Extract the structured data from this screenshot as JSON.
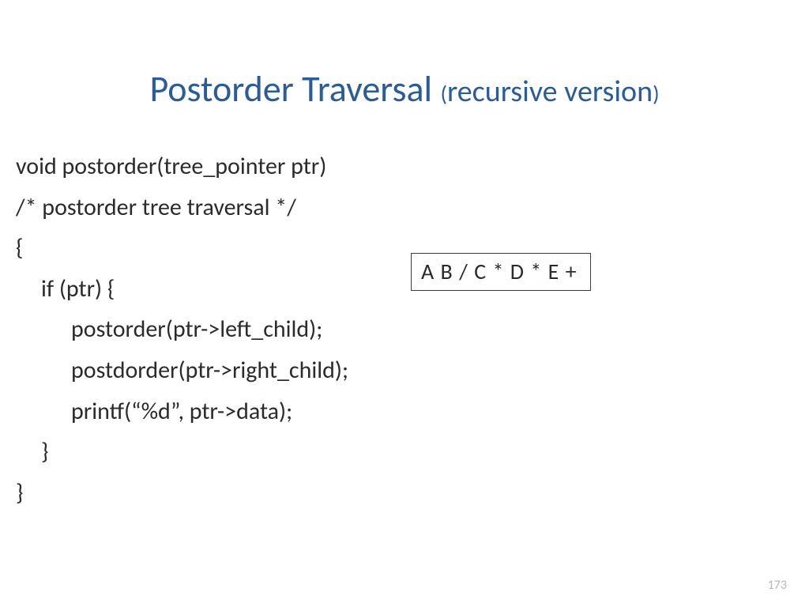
{
  "title": {
    "main": "Postorder Traversal",
    "open_paren": "(",
    "sub": "recursive  version",
    "close_paren": ")"
  },
  "code": {
    "l1": "void postorder(tree_pointer ptr)",
    "l2": "/* postorder tree traversal */",
    "l3": "{",
    "l4": "if (ptr) {",
    "l5": "postorder(ptr->left_child);",
    "l6": "postdorder(ptr->right_child);",
    "l7": "printf(“%d”, ptr->data);",
    "l8": "}",
    "l9": "}"
  },
  "output": "A B / C * D * E +",
  "page_number": "173"
}
